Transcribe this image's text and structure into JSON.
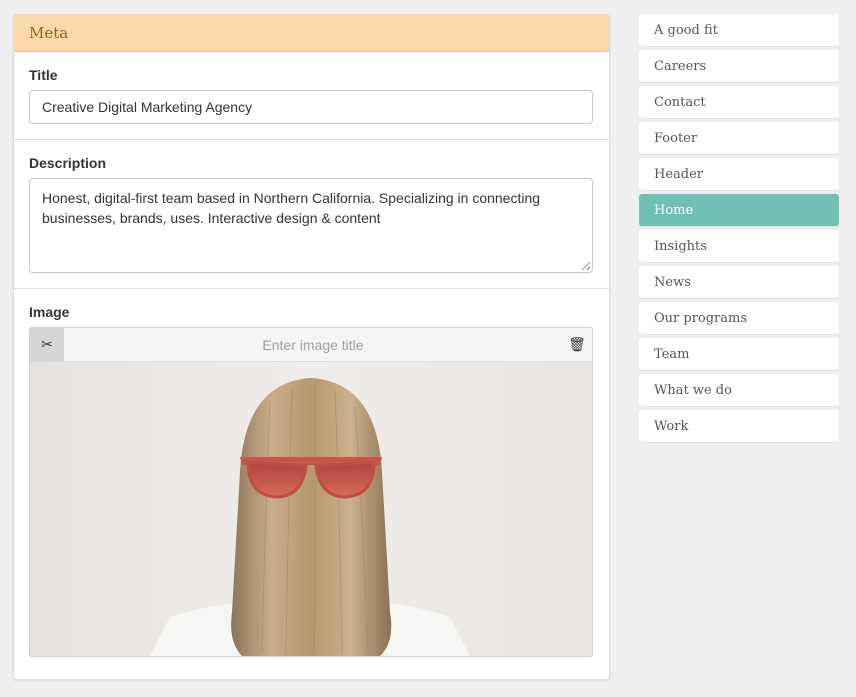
{
  "meta_panel": {
    "header": "Meta",
    "title": {
      "label": "Title",
      "value": "Creative Digital Marketing Agency"
    },
    "description": {
      "label": "Description",
      "line1": "Honest, digital-first team based in Northern California. Specializing in connecting",
      "line2": "businesses, brands, uses. Interactive design & content"
    },
    "image": {
      "label": "Image",
      "title_placeholder": "Enter image title",
      "crop_icon": "✂",
      "trash_icon": "🗑"
    }
  },
  "sidebar": {
    "active_color": "#70c1b3",
    "items": [
      {
        "label": "A good fit"
      },
      {
        "label": "Careers"
      },
      {
        "label": "Contact"
      },
      {
        "label": "Footer"
      },
      {
        "label": "Header"
      },
      {
        "label": "Home",
        "active": true
      },
      {
        "label": "Insights"
      },
      {
        "label": "News"
      },
      {
        "label": "Our programs"
      },
      {
        "label": "Team"
      },
      {
        "label": "What we do"
      },
      {
        "label": "Work"
      }
    ]
  }
}
